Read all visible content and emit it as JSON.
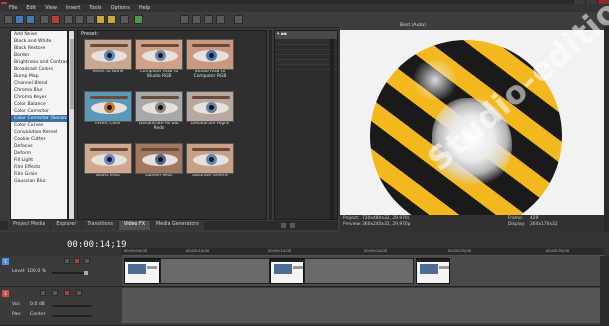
{
  "window": {
    "title": ""
  },
  "menu": [
    "File",
    "Edit",
    "View",
    "Insert",
    "Tools",
    "Options",
    "Help"
  ],
  "effects_list": [
    "Add Noise",
    "Black and White",
    "Black Restore",
    "Border",
    "Brightness and Contrast",
    "Broadcast Colors",
    "Bump Map",
    "Channel Blend",
    "Chroma Blur",
    "Chroma Keyer",
    "Color Balance",
    "Color Corrector",
    "Color Corrector (Secondary)",
    "Color Curves",
    "Convolution Kernel",
    "Cookie Cutter",
    "Defocus",
    "Deform",
    "Fill Light",
    "Film Effects",
    "Film Grain",
    "Gaussian Blur"
  ],
  "selected_effect_index": 12,
  "presets": {
    "header": "Preset:",
    "items": [
      {
        "label": "Reset to None",
        "iris": "#5a8ac0",
        "tint": "#c8a890"
      },
      {
        "label": "Computer RGB to Studio RGB",
        "iris": "#6a88b0",
        "tint": "#d0a088"
      },
      {
        "label": "Studio RGB to Computer RGB",
        "iris": "#4a7ab8",
        "tint": "#c89880"
      },
      {
        "label": "Invert Color",
        "iris": "#c07a40",
        "tint": "#5a9ab8"
      },
      {
        "label": "Desaturate All but Reds",
        "iris": "#888888",
        "tint": "#a8a8a8"
      },
      {
        "label": "Desaturate Highs",
        "iris": "#6a82a0",
        "tint": "#b8a8a0"
      },
      {
        "label": "Boost Mids",
        "iris": "#6a8ac8",
        "tint": "#d0a890"
      },
      {
        "label": "Darken Mids",
        "iris": "#4a6a98",
        "tint": "#a07860"
      },
      {
        "label": "Saturate Greens",
        "iris": "#5a8ab8",
        "tint": "#c8a088"
      }
    ]
  },
  "preview": {
    "quality": "Best (Auto)",
    "info": {
      "project_label": "Project:",
      "project_value": "720x480x32, 29.970i",
      "preview_label": "Preview:",
      "preview_value": "360x240x32, 29.970p",
      "frame_label": "Frame:",
      "frame_value": "429",
      "display_label": "Display:",
      "display_value": "264x176x32"
    }
  },
  "tabs": [
    "Project Media",
    "Explorer",
    "Transitions",
    "Video FX",
    "Media Generators"
  ],
  "active_tab_index": 3,
  "timeline": {
    "timecode": "00:00:14;19",
    "ruler": [
      "00:00:00;00",
      "00:00:10;00",
      "00:00:15;00",
      "00:00:20;00",
      "00:00:25;00",
      "00:00:30;00"
    ]
  },
  "video_track": {
    "number": "1",
    "level_label": "Level: 100.0 %"
  },
  "audio_track": {
    "number": "2",
    "vol_label": "Vol:",
    "vol_value": "0.0 dB",
    "pan_label": "Pan:",
    "pan_value": "Center"
  },
  "watermark": "Studio-edition.ru",
  "colors": {
    "accent": "#3a6ea5",
    "stripe_yellow": "#f2b81e",
    "stripe_black": "#1a1a1a"
  }
}
